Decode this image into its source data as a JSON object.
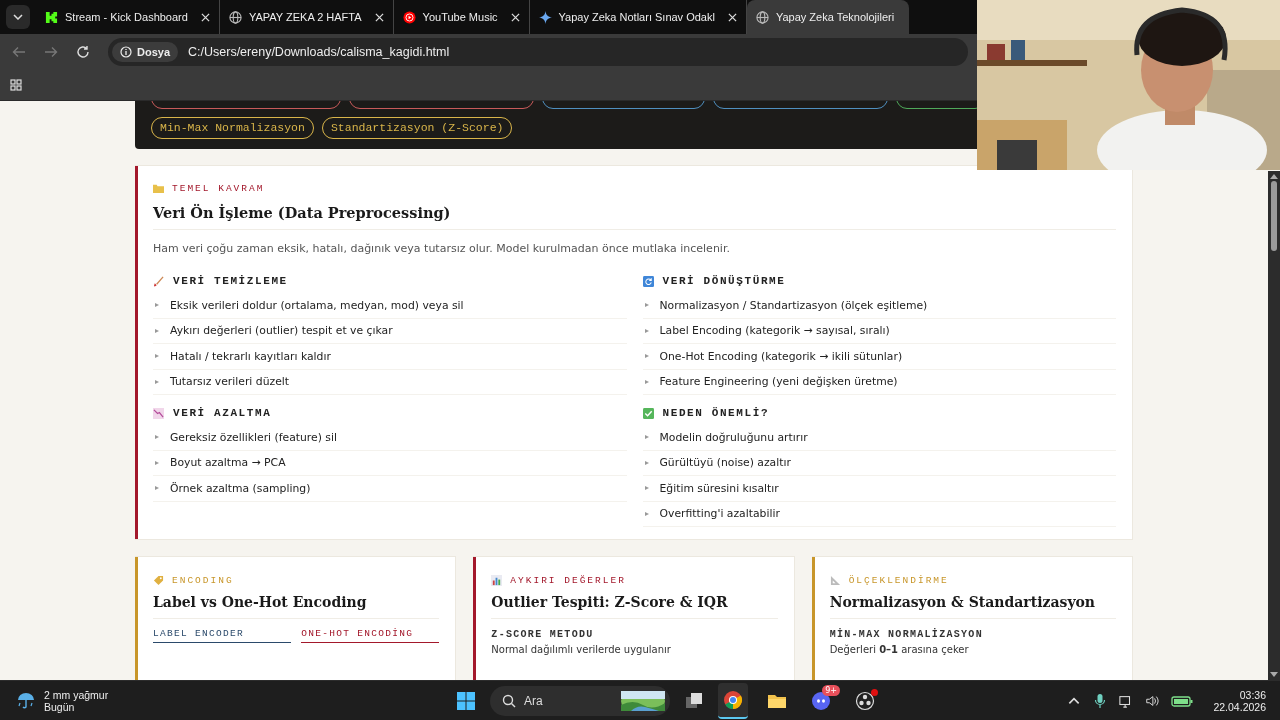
{
  "browser": {
    "tabs": [
      {
        "title": "Stream - Kick Dashboard",
        "selected": false
      },
      {
        "title": "YAPAY ZEKA 2 HAFTA",
        "selected": false
      },
      {
        "title": "YouTube Music",
        "selected": false
      },
      {
        "title": "Yapay Zeka Notları Sınav Odakl",
        "selected": false
      },
      {
        "title": "Yapay Zeka Teknolojileri",
        "selected": true
      }
    ],
    "address": {
      "badge": "Dosya",
      "url": "C:/Users/ereny/Downloads/calisma_kagidi.html"
    }
  },
  "tag_panel": {
    "clipped_tags": [
      {
        "color": "#c85a5a"
      },
      {
        "color": "#c85a5a"
      },
      {
        "color": "#4f8fbf"
      },
      {
        "color": "#4f8fbf"
      },
      {
        "color": "#4fa85a"
      }
    ],
    "tags": [
      {
        "label": "Min-Max Normalizasyon",
        "color": "#d9b54a"
      },
      {
        "label": "Standartizasyon (Z-Score)",
        "color": "#d9b54a"
      }
    ]
  },
  "concept": {
    "category": "TEMEL KAVRAM",
    "color": "#a3182b",
    "title": "Veri Ön İşleme (Data Preprocessing)",
    "intro": "Ham veri çoğu zaman eksik, hatalı, dağınık veya tutarsız olur. Model kurulmadan önce mutlaka incelenir.",
    "columns": [
      [
        {
          "title": "VERİ TEMİZLEME",
          "items": [
            "Eksik verileri doldur (ortalama, medyan, mod) veya sil",
            "Aykırı değerleri (outlier) tespit et ve çıkar",
            "Hatalı / tekrarlı kayıtları kaldır",
            "Tutarsız verileri düzelt"
          ]
        },
        {
          "title": "VERİ AZALTMA",
          "items": [
            "Gereksiz özellikleri (feature) sil",
            "Boyut azaltma → PCA",
            "Örnek azaltma (sampling)"
          ]
        }
      ],
      [
        {
          "title": "VERİ DÖNÜŞTÜRME",
          "items": [
            "Normalizasyon / Standartizasyon (ölçek eşitleme)",
            "Label Encoding (kategorik → sayısal, sıralı)",
            "One-Hot Encoding (kategorik → ikili sütunlar)",
            "Feature Engineering (yeni değişken üretme)"
          ]
        },
        {
          "title": "NEDEN ÖNEMLİ?",
          "items": [
            "Modelin doğruluğunu artırır",
            "Gürültüyü (noise) azaltır",
            "Eğitim süresini kısaltır",
            "Overfitting'i azaltabilir"
          ]
        }
      ]
    ]
  },
  "cards": [
    {
      "kind": "columns",
      "category": "ENCODING",
      "color": "#c8962a",
      "title": "Label vs One-Hot Encoding",
      "columns": [
        {
          "label": "LABEL ENCODER",
          "color": "#2b4a6b"
        },
        {
          "label": "ONE-HOT ENCODİNG",
          "color": "#a3182b"
        }
      ]
    },
    {
      "kind": "method",
      "category": "AYKIRI DEĞERLER",
      "color": "#a3182b",
      "title": "Outlier Tespiti: Z-Score & IQR",
      "subhead": "Z-SCORE METODU",
      "text": "Normal dağılımlı verilerde uygulanır"
    },
    {
      "kind": "method",
      "category": "ÖLÇEKLENDİRME",
      "color": "#c8962a",
      "title": "Normalizasyon & Standartizasyon",
      "subhead": "MİN-MAX NORMALİZASYON",
      "text": "Değerleri **0–1** arasına çeker"
    }
  ],
  "taskbar": {
    "weather": {
      "title": "2 mm yağmur",
      "subtitle": "Bugün"
    },
    "search": {
      "placeholder": "Ara"
    },
    "apps": [
      {
        "active": true,
        "alert": false
      },
      {
        "active": false,
        "alert": false
      },
      {
        "active": false,
        "alert": false,
        "badge": "9+"
      },
      {
        "active": false,
        "alert": true
      }
    ],
    "time": "03:36",
    "date": "22.04.2026"
  }
}
